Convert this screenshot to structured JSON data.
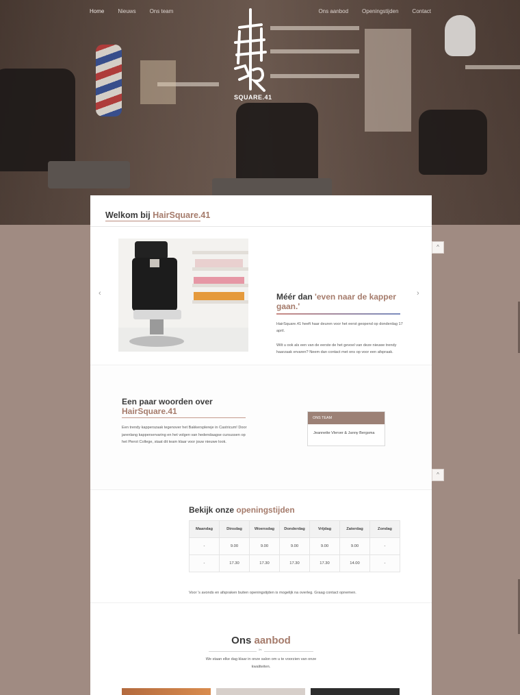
{
  "nav": {
    "left": [
      "Home",
      "Nieuws",
      "Ons team"
    ],
    "right": [
      "Ons aanbod",
      "Openingstijden",
      "Contact"
    ],
    "active": "Home"
  },
  "logo": {
    "text": "SQUARE.41"
  },
  "welcome": {
    "prefix": "Welkom bij ",
    "brand": "HairSquare.41"
  },
  "slider": {
    "heading_prefix": "Méér dan ",
    "heading_accent": "'even naar de kapper gaan.'",
    "paragraph_1": "HairSquare.41 heeft haar deuren voor het eerst geopend op donderdag 17 april.",
    "paragraph_2": "Wilt u ook als een van de eerste de het gevoel van deze nieuwe trendy haarzaak ervaren? Neem dan contact met ons op voor een afspraak.",
    "prev_icon": "chevron-left-icon",
    "next_icon": "chevron-right-icon"
  },
  "about": {
    "heading_prefix": "Een paar woorden over",
    "heading_accent": "HairSquare.41",
    "paragraph": "Een trendy kapperszaak tegenover het Bakkersplereje in Castricum! Door jarenlang kapperservaring en het volgen van hedendaagse cursussen op het Pierot College, staat dit team klaar voor jouw nieuwe look.",
    "team_box": {
      "title": "ONS TEAM",
      "members": "Jeannette Vlerver & Janny Bergsma"
    }
  },
  "hours": {
    "heading_prefix": "Bekijk onze ",
    "heading_accent": "openingstijden",
    "days": [
      "Maandag",
      "Dinsdag",
      "Woensdag",
      "Donderdag",
      "Vrijdag",
      "Zaterdag",
      "Zondag"
    ],
    "open": [
      "-",
      "9.00",
      "9.00",
      "9.00",
      "9.00",
      "9.00",
      "-"
    ],
    "close": [
      "-",
      "17.30",
      "17.30",
      "17.30",
      "17.30",
      "14.00",
      "-"
    ],
    "note": "Voor 's avonds en afspraken buiten openingstijden is mogelijk na overleg. Graag contact opnemen."
  },
  "offer": {
    "heading_prefix": "Ons ",
    "heading_accent": "aanbod",
    "divider_icon": "scissors-icon",
    "scissor_glyph": "✂",
    "paragraph": "We staan elke dag klaar in onze salon om u te voorzien van onze kwaliteiten."
  },
  "controls": {
    "up_glyph": "^"
  },
  "colors": {
    "accent": "#a57b6b",
    "background": "#a08b82",
    "team_header": "#9c8176"
  }
}
